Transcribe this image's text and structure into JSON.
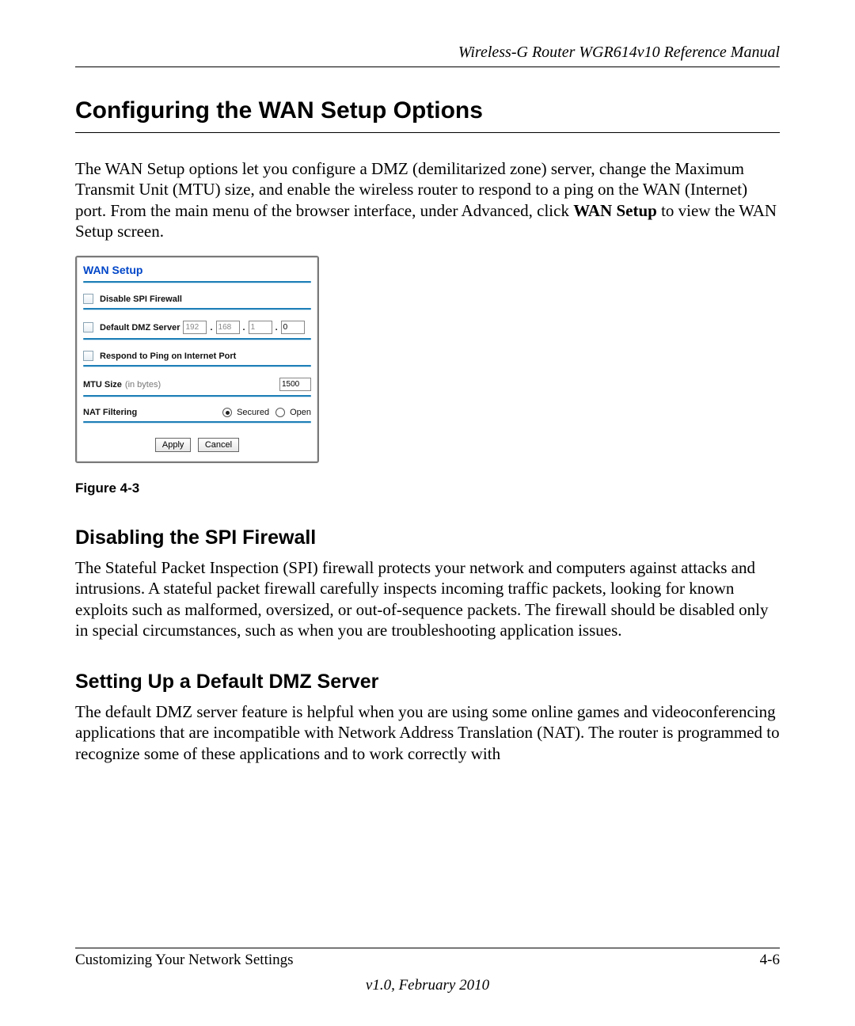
{
  "header": {
    "doc_title": "Wireless-G Router WGR614v10 Reference Manual"
  },
  "section": {
    "title": "Configuring the WAN Setup Options",
    "intro_part1": "The WAN Setup options let you configure a DMZ (demilitarized zone) server, change the Maximum Transmit Unit (MTU) size, and enable the wireless router to respond to a ping on the WAN (Internet) port. From the main menu of the browser interface, under Advanced, click ",
    "intro_bold": "WAN Setup",
    "intro_part2": " to view the WAN Setup screen."
  },
  "screenshot": {
    "title": "WAN Setup",
    "disable_spi": "Disable SPI Firewall",
    "dmz_label": "Default DMZ Server",
    "dmz_ip": [
      "192",
      "168",
      "1",
      "0"
    ],
    "ping_label": "Respond to Ping on Internet Port",
    "mtu_label": "MTU Size",
    "mtu_units": "(in bytes)",
    "mtu_value": "1500",
    "nat_label": "NAT Filtering",
    "nat_options": [
      "Secured",
      "Open"
    ],
    "buttons": {
      "apply": "Apply",
      "cancel": "Cancel"
    }
  },
  "figure_caption": "Figure 4-3",
  "sub1": {
    "title": "Disabling the SPI Firewall",
    "text": "The Stateful Packet Inspection (SPI) firewall protects your network and computers against attacks and intrusions. A stateful packet firewall carefully inspects incoming traffic packets, looking for known exploits such as malformed, oversized, or out-of-sequence packets. The firewall should be disabled only in special circumstances, such as when you are troubleshooting application issues."
  },
  "sub2": {
    "title": "Setting Up a Default DMZ Server",
    "text": "The default DMZ server feature is helpful when you are using some online games and videoconferencing applications that are incompatible with Network Address Translation (NAT). The router is programmed to recognize some of these applications and to work correctly with"
  },
  "footer": {
    "left": "Customizing Your Network Settings",
    "right": "4-6",
    "version": "v1.0, February 2010"
  }
}
